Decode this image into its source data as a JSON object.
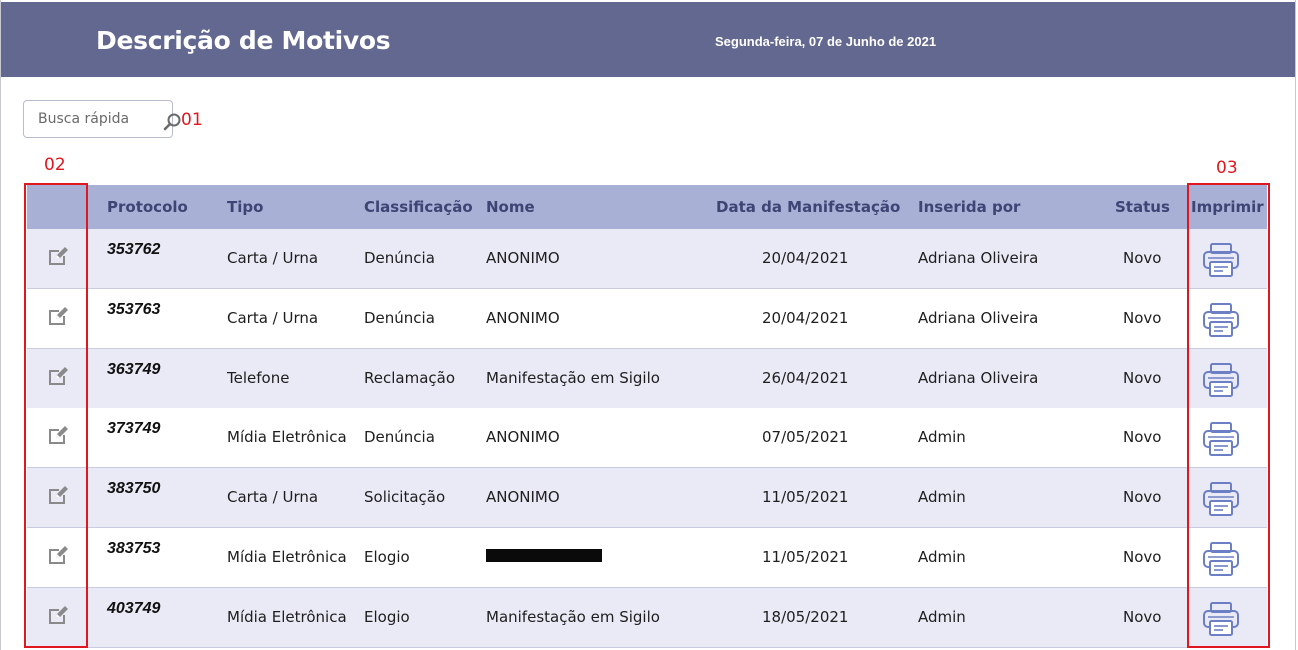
{
  "header": {
    "title": "Descrição de Motivos",
    "date": "Segunda-feira, 07 de Junho de 2021"
  },
  "search": {
    "placeholder": "Busca rápida",
    "icon": "search-icon"
  },
  "annotations": {
    "search": "01",
    "edit_column": "02",
    "print_column": "03",
    "color": "#e0171f"
  },
  "table": {
    "columns": {
      "protocolo": "Protocolo",
      "tipo": "Tipo",
      "classificacao": "Classificação",
      "nome": "Nome",
      "data": "Data da Manifestação",
      "inserida": "Inserida por",
      "status": "Status",
      "imprimir": "Imprimir"
    },
    "rows": [
      {
        "protocolo": "353762",
        "tipo": "Carta / Urna",
        "classificacao": "Denúncia",
        "nome": "ANONIMO",
        "data": "20/04/2021",
        "inserida": "Adriana Oliveira",
        "status": "Novo"
      },
      {
        "protocolo": "353763",
        "tipo": "Carta / Urna",
        "classificacao": "Denúncia",
        "nome": "ANONIMO",
        "data": "20/04/2021",
        "inserida": "Adriana Oliveira",
        "status": "Novo"
      },
      {
        "protocolo": "363749",
        "tipo": "Telefone",
        "classificacao": "Reclamação",
        "nome": "Manifestação em Sigilo",
        "data": "26/04/2021",
        "inserida": "Adriana Oliveira",
        "status": "Novo"
      },
      {
        "protocolo": "373749",
        "tipo": "Mídia Eletrônica",
        "classificacao": "Denúncia",
        "nome": "ANONIMO",
        "data": "07/05/2021",
        "inserida": "Admin",
        "status": "Novo"
      },
      {
        "protocolo": "383750",
        "tipo": "Carta / Urna",
        "classificacao": "Solicitação",
        "nome": "ANONIMO",
        "data": "11/05/2021",
        "inserida": "Admin",
        "status": "Novo"
      },
      {
        "protocolo": "383753",
        "tipo": "Mídia Eletrônica",
        "classificacao": "Elogio",
        "nome": "",
        "data": "11/05/2021",
        "inserida": "Admin",
        "status": "Novo"
      },
      {
        "protocolo": "403749",
        "tipo": "Mídia Eletrônica",
        "classificacao": "Elogio",
        "nome": "Manifestação em Sigilo",
        "data": "18/05/2021",
        "inserida": "Admin",
        "status": "Novo"
      }
    ]
  },
  "icons": {
    "edit": "edit-icon",
    "print": "print-icon"
  },
  "colors": {
    "header_bg": "#62688f",
    "table_header_bg": "#a9b0d6",
    "row_alt_bg": "#e9eaf5",
    "icon_blue": "#6d7fc4"
  }
}
